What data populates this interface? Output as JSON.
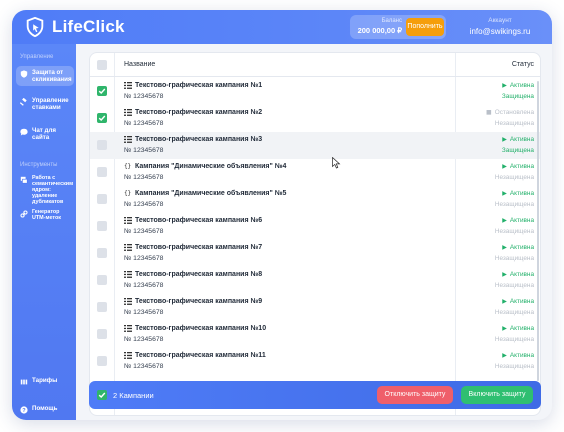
{
  "app": {
    "name": "LifeClick"
  },
  "header": {
    "balance_label": "Баланс",
    "balance_value": "200 000,00 ₽",
    "topup_label": "Пополнить",
    "account_label": "Аккаунт",
    "account_email": "info@swikings.ru"
  },
  "sidebar": {
    "section_control": "Управление",
    "section_tools": "Инструменты",
    "items": [
      {
        "label": "Защита от скликивания",
        "icon": "shield-icon",
        "active": true
      },
      {
        "label": "Управление ставками",
        "icon": "gavel-icon",
        "active": false
      },
      {
        "label": "Чат для сайта",
        "icon": "chat-icon",
        "active": false
      },
      {
        "label": "Работа с семантическим ядром: удаление дубликатов",
        "icon": "layers-icon",
        "active": false
      },
      {
        "label": "Генератор UTM-меток",
        "icon": "link-icon",
        "active": false
      },
      {
        "label": "Тарифы",
        "icon": "tariff-icon",
        "active": false
      },
      {
        "label": "Помощь",
        "icon": "help-icon",
        "active": false
      }
    ]
  },
  "table": {
    "col_name": "Название",
    "col_status": "Статус",
    "rows": [
      {
        "title": "Текстово-графическая кампания №1",
        "number": "№ 12345678",
        "type": "text-graphic",
        "checked": true,
        "status": "Активна",
        "status_active": true,
        "protection": "Защищена",
        "protected": true
      },
      {
        "title": "Текстово-графическая кампания №2",
        "number": "№ 12345678",
        "type": "text-graphic",
        "checked": true,
        "status": "Остановлена",
        "status_active": false,
        "protection": "Незащищена",
        "protected": false
      },
      {
        "title": "Текстово-графическая кампания №3",
        "number": "№ 12345678",
        "type": "text-graphic",
        "checked": false,
        "status": "Активна",
        "status_active": true,
        "protection": "Защищена",
        "protected": true
      },
      {
        "title": "Кампания \"Динамические объявления\" №4",
        "number": "№ 12345678",
        "type": "dynamic",
        "checked": false,
        "status": "Активна",
        "status_active": true,
        "protection": "Незащищена",
        "protected": false
      },
      {
        "title": "Кампания \"Динамические объявления\" №5",
        "number": "№ 12345678",
        "type": "dynamic",
        "checked": false,
        "status": "Активна",
        "status_active": true,
        "protection": "Незащищена",
        "protected": false
      },
      {
        "title": "Текстово-графическая кампания №6",
        "number": "№ 12345678",
        "type": "text-graphic",
        "checked": false,
        "status": "Активна",
        "status_active": true,
        "protection": "Незащищена",
        "protected": false
      },
      {
        "title": "Текстово-графическая кампания №7",
        "number": "№ 12345678",
        "type": "text-graphic",
        "checked": false,
        "status": "Активна",
        "status_active": true,
        "protection": "Незащищена",
        "protected": false
      },
      {
        "title": "Текстово-графическая кампания №8",
        "number": "№ 12345678",
        "type": "text-graphic",
        "checked": false,
        "status": "Активна",
        "status_active": true,
        "protection": "Незащищена",
        "protected": false
      },
      {
        "title": "Текстово-графическая кампания №9",
        "number": "№ 12345678",
        "type": "text-graphic",
        "checked": false,
        "status": "Активна",
        "status_active": true,
        "protection": "Незащищена",
        "protected": false
      },
      {
        "title": "Текстово-графическая кампания №10",
        "number": "№ 12345678",
        "type": "text-graphic",
        "checked": false,
        "status": "Активна",
        "status_active": true,
        "protection": "Незащищена",
        "protected": false
      },
      {
        "title": "Текстово-графическая кампания №11",
        "number": "№ 12345678",
        "type": "text-graphic",
        "checked": false,
        "status": "Активна",
        "status_active": true,
        "protection": "Незащищена",
        "protected": false
      }
    ]
  },
  "actionbar": {
    "selected_count": "2 Кампании",
    "disable_label": "Отключить защиту",
    "enable_label": "Включить защиту"
  },
  "colors": {
    "brand": "#4f7cf7",
    "active": "#22b06a",
    "inactive": "#b9bfc8",
    "danger": "#ef5f6a",
    "accent": "#f59e0b"
  }
}
